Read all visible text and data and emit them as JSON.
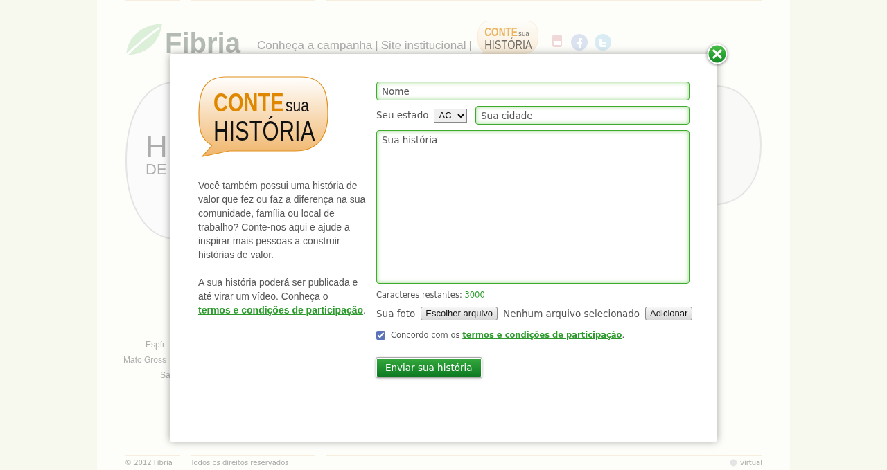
{
  "background_page": {
    "logo": "Fibria",
    "nav": [
      "Conheça a campanha",
      "Site institucional"
    ],
    "nav_separator": "|",
    "badge": {
      "word1": "CONTE",
      "word2": "sua",
      "word3": "HISTÓRIA"
    },
    "side_texts": [
      {
        "kind": "big",
        "text": "H"
      },
      {
        "kind": "mid",
        "text": "DE"
      },
      {
        "kind": "small",
        "text": "Espír"
      },
      {
        "kind": "small",
        "text": "Mato Gross"
      },
      {
        "kind": "small",
        "text": "Sã"
      }
    ],
    "footer": [
      "© 2012 Fibria",
      "Todos os direitos reservados"
    ],
    "footer_credit": "virtual"
  },
  "dialog": {
    "logo": {
      "word1": "CONTE",
      "word2": "sua",
      "word3": "HISTÓRIA"
    },
    "intro": "Você também possui uma história de valor que fez ou faz a diferença na sua comunidade, família ou local de trabalho? Conte-nos aqui e ajude a inspirar mais pessoas a construir histórias de valor.",
    "note": "A sua história poderá ser publicada e até virar um vídeo. Conheça o",
    "note_link": "termos e condições de participação",
    "note_end": ".",
    "form": {
      "name": {
        "placeholder": "Nome"
      },
      "state_label": "Seu estado",
      "state": {
        "value": "AC"
      },
      "city": {
        "placeholder": "Sua cidade"
      },
      "story": {
        "placeholder": "Sua história"
      },
      "counter_label": "Caracteres restantes:",
      "counter": "3000",
      "photo_label": "Sua foto",
      "file_button": "Escolher arquivo",
      "file_status": "Nenhum arquivo selecionado",
      "add_button": "Adicionar",
      "agree": {
        "checked": true,
        "text": "Concordo com os",
        "link": "termos e condições de participação",
        "end": "."
      },
      "submit": "Enviar sua história"
    }
  }
}
